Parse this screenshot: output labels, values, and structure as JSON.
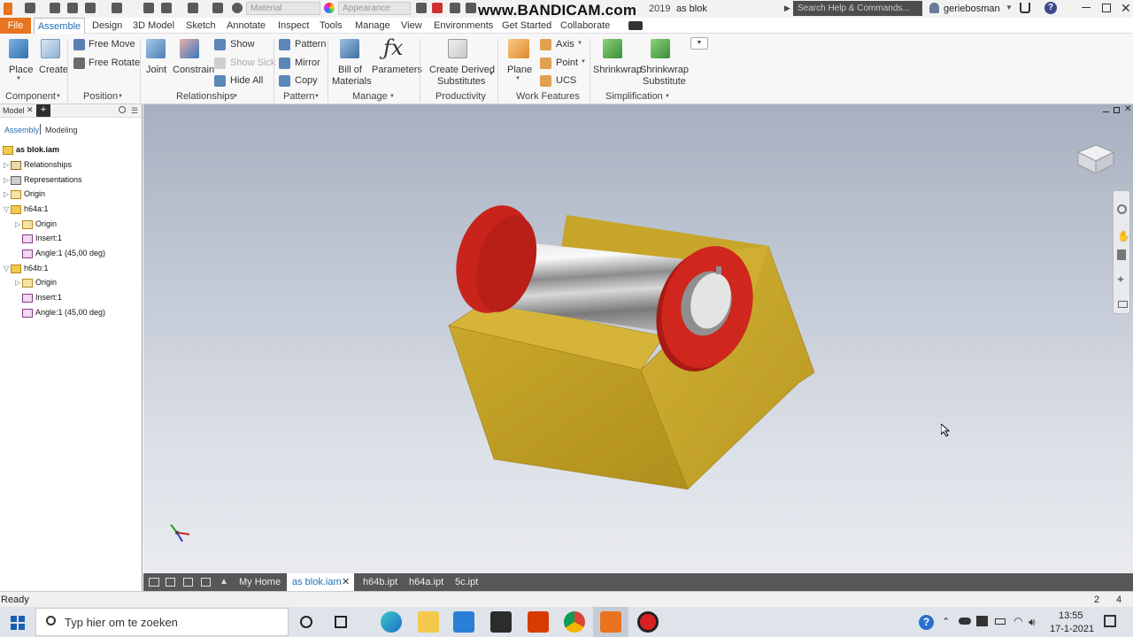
{
  "title_bar": {
    "document_title": "as blok",
    "material_field": "Material",
    "appearance_field": "Appearance",
    "search_placeholder": "Search Help & Commands...",
    "username": "geriebosman",
    "watermark": "www.BANDICAM.com",
    "partial_title": "2019"
  },
  "menu": {
    "file": "File",
    "tabs": [
      "Assemble",
      "Design",
      "3D Model",
      "Sketch",
      "Annotate",
      "Inspect",
      "Tools",
      "Manage",
      "View",
      "Environments",
      "Get Started",
      "Collaborate"
    ],
    "active": "Assemble"
  },
  "ribbon": {
    "component": {
      "label": "Component",
      "place": "Place",
      "create": "Create"
    },
    "position": {
      "label": "Position",
      "free_move": "Free Move",
      "free_rotate": "Free Rotate"
    },
    "relationships": {
      "label": "Relationships",
      "joint": "Joint",
      "constrain": "Constrain",
      "show": "Show",
      "show_sick": "Show Sick",
      "hide_all": "Hide All"
    },
    "pattern": {
      "label": "Pattern",
      "pattern": "Pattern",
      "mirror": "Mirror",
      "copy": "Copy"
    },
    "manage": {
      "label": "Manage",
      "bom_line1": "Bill of",
      "bom_line2": "Materials",
      "parameters": "Parameters"
    },
    "productivity": {
      "label": "Productivity",
      "cds_line1": "Create Derived",
      "cds_line2": "Substitutes"
    },
    "work_features": {
      "label": "Work Features",
      "plane": "Plane",
      "axis": "Axis",
      "point": "Point",
      "ucs": "UCS"
    },
    "simplification": {
      "label": "Simplification",
      "shrinkwrap": "Shrinkwrap",
      "sws_line1": "Shrinkwrap",
      "sws_line2": "Substitute"
    }
  },
  "browser": {
    "panel_title": "Model",
    "add_tab": "+",
    "mode_assembly": "Assembly",
    "mode_modeling": "Modeling",
    "tree": [
      {
        "label": "as blok.iam",
        "level": 0,
        "bold": true,
        "icon": "assembly-icon"
      },
      {
        "label": "Relationships",
        "level": 1,
        "icon": "relationships-icon"
      },
      {
        "label": "Representations",
        "level": 1,
        "icon": "representations-icon"
      },
      {
        "label": "Origin",
        "level": 1,
        "icon": "folder-icon"
      },
      {
        "label": "h64a:1",
        "level": 1,
        "icon": "part-icon",
        "expanded": true
      },
      {
        "label": "Origin",
        "level": 2,
        "icon": "folder-icon"
      },
      {
        "label": "Insert:1",
        "level": 2,
        "icon": "insert-constraint-icon"
      },
      {
        "label": "Angle:1 (45,00 deg)",
        "level": 2,
        "icon": "angle-constraint-icon"
      },
      {
        "label": "h64b:1",
        "level": 1,
        "icon": "part-icon",
        "expanded": true
      },
      {
        "label": "Origin",
        "level": 2,
        "icon": "folder-icon"
      },
      {
        "label": "Insert:1",
        "level": 2,
        "icon": "insert-constraint-icon"
      },
      {
        "label": "Angle:1 (45,00 deg)",
        "level": 2,
        "icon": "angle-constraint-icon"
      }
    ]
  },
  "doc_tabs": {
    "my_home": "My Home",
    "tabs": [
      "as blok.iam",
      "h64b.ipt",
      "h64a.ipt",
      "5c.ipt"
    ],
    "active": "as blok.iam"
  },
  "status_bar": {
    "status": "Ready",
    "count1": "2",
    "count2": "4"
  },
  "taskbar": {
    "search_placeholder": "Typ hier om te zoeken",
    "time": "13:55",
    "date": "17-1-2021"
  },
  "colors": {
    "file_tab": "#e8741f",
    "active_tab": "#1f6fb5",
    "block": "#c9a830",
    "flange": "#c8241c"
  }
}
